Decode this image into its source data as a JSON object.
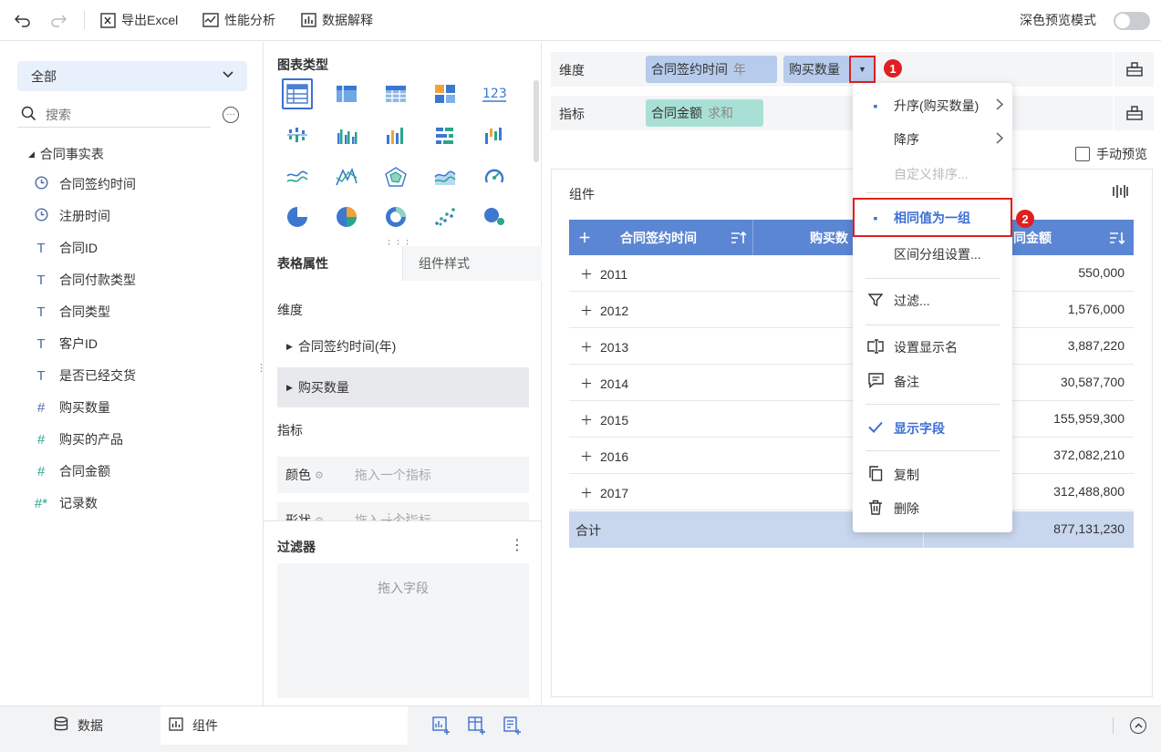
{
  "toolbar": {
    "export_label": "导出Excel",
    "perf_label": "性能分析",
    "explain_label": "数据解释",
    "dark_preview_label": "深色预览模式"
  },
  "left": {
    "select_value": "全部",
    "search_placeholder": "搜索",
    "table_name": "合同事实表",
    "fields": [
      {
        "name": "合同签约时间",
        "icon": "clock-icon"
      },
      {
        "name": "注册时间",
        "icon": "clock-icon"
      },
      {
        "name": "合同ID",
        "icon": "text-type-icon"
      },
      {
        "name": "合同付款类型",
        "icon": "text-type-icon"
      },
      {
        "name": "合同类型",
        "icon": "text-type-icon"
      },
      {
        "name": "客户ID",
        "icon": "text-type-icon"
      },
      {
        "name": "是否已经交货",
        "icon": "text-type-icon"
      },
      {
        "name": "购买数量",
        "icon": "hash-icon"
      },
      {
        "name": "购买的产品",
        "icon": "hash-icon"
      },
      {
        "name": "合同金额",
        "icon": "hash-icon"
      },
      {
        "name": "记录数",
        "icon": "hash-star-icon"
      }
    ]
  },
  "middle": {
    "chart_types_title": "图表类型",
    "tab_table_props": "表格属性",
    "tab_component_style": "组件样式",
    "dimension_label": "维度",
    "dim_item_1": "合同签约时间(年)",
    "dim_item_2": "购买数量",
    "metric_label": "指标",
    "color_label": "颜色",
    "shape_label": "形状",
    "drop_metric_hint": "拖入一个指标",
    "filter_title": "过滤器",
    "filter_drop_hint": "拖入字段"
  },
  "right": {
    "dim_shelf_label": "维度",
    "dim_pill_1": "合同签约时间",
    "dim_pill_1_sub": "年",
    "dim_pill_2": "购买数量",
    "metric_shelf_label": "指标",
    "metric_pill": "合同金额",
    "metric_pill_sub": "求和",
    "manual_preview": "手动预览",
    "component_title": "组件",
    "badge_1": "1",
    "badge_2": "2"
  },
  "table": {
    "col_time": "合同签约时间",
    "col_qty": "购买数",
    "col_amount": "同金额",
    "rows": [
      {
        "year": "2011",
        "amount": "550,000"
      },
      {
        "year": "2012",
        "amount": "1,576,000"
      },
      {
        "year": "2013",
        "amount": "3,887,220"
      },
      {
        "year": "2014",
        "amount": "30,587,700"
      },
      {
        "year": "2015",
        "amount": "155,959,300"
      },
      {
        "year": "2016",
        "amount": "372,082,210"
      },
      {
        "year": "2017",
        "amount": "312,488,800"
      }
    ],
    "total_label": "合计",
    "total_amount": "877,131,230"
  },
  "menu": {
    "asc": "升序(购买数量)",
    "desc": "降序",
    "custom_sort": "自定义排序...",
    "same_value_group": "相同值为一组",
    "interval_group": "区间分组设置...",
    "filter": "过滤...",
    "display_name": "设置显示名",
    "note": "备注",
    "show_field": "显示字段",
    "copy": "复制",
    "delete": "删除"
  },
  "bottom": {
    "data_tab": "数据",
    "component_tab": "组件"
  },
  "colors": {
    "accent": "#3b6fd3",
    "table_header": "#5b86d3",
    "highlight_red": "#e02020"
  }
}
